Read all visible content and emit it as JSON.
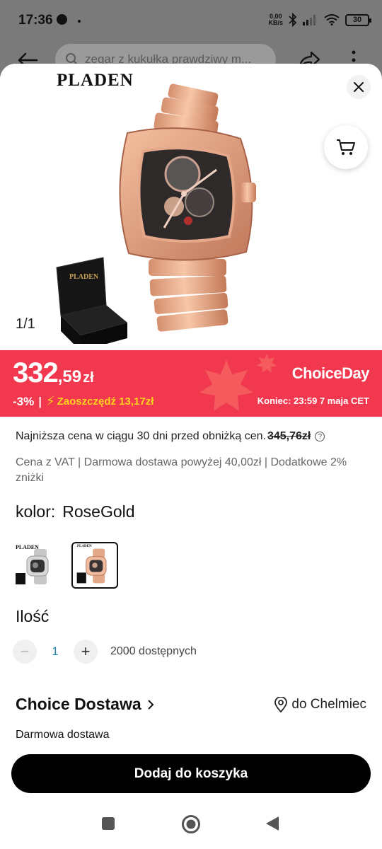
{
  "status": {
    "time": "17:36",
    "net_speed_value": "0,00",
    "net_speed_unit": "KB/s",
    "battery": "30"
  },
  "header": {
    "search_placeholder": "zegar z kukułka prawdziwy m..."
  },
  "gallery": {
    "brand": "PLADEN",
    "counter": "1/1",
    "box_label": "PLADEN"
  },
  "price": {
    "integer": "332",
    "decimal": ",59",
    "currency": "zł",
    "discount": "-3%",
    "separator": "|",
    "savings": "Zaoszczędź 13,17zł",
    "campaign": "ChoiceDay",
    "ends": "Koniec: 23:59 7 maja CET",
    "banner_color": "#f2384f",
    "savings_color": "#ffd21f"
  },
  "lowest_price": {
    "text": "Najniższa cena w ciągu 30 dni przed obniżką cen.",
    "old_price": "345,76zł",
    "info_icon": "?"
  },
  "vat_line": "Cena z VAT | Darmowa dostawa powyżej 40,00zł | Dodatkowe 2% zniżki",
  "color": {
    "label": "kolor:",
    "value": "RoseGold",
    "variants": [
      {
        "name": "Silver",
        "logo": "PLADEN"
      },
      {
        "name": "RoseGold",
        "logo": "PLADEN"
      }
    ]
  },
  "quantity": {
    "label": "Ilość",
    "minus": "−",
    "value": "1",
    "plus": "+",
    "available": "2000 dostępnych"
  },
  "delivery": {
    "title": "Choice Dostawa",
    "location": "do Chelmiec",
    "free": "Darmowa dostawa"
  },
  "actions": {
    "add_to_cart": "Dodaj do koszyka"
  },
  "icons": [
    "back-arrow-icon",
    "search-icon",
    "share-icon",
    "more-icon",
    "close-icon",
    "cart-icon",
    "info-icon",
    "bolt-icon",
    "chevron-right-icon",
    "location-pin-icon",
    "nav-recents-icon",
    "nav-home-icon",
    "nav-back-icon"
  ]
}
